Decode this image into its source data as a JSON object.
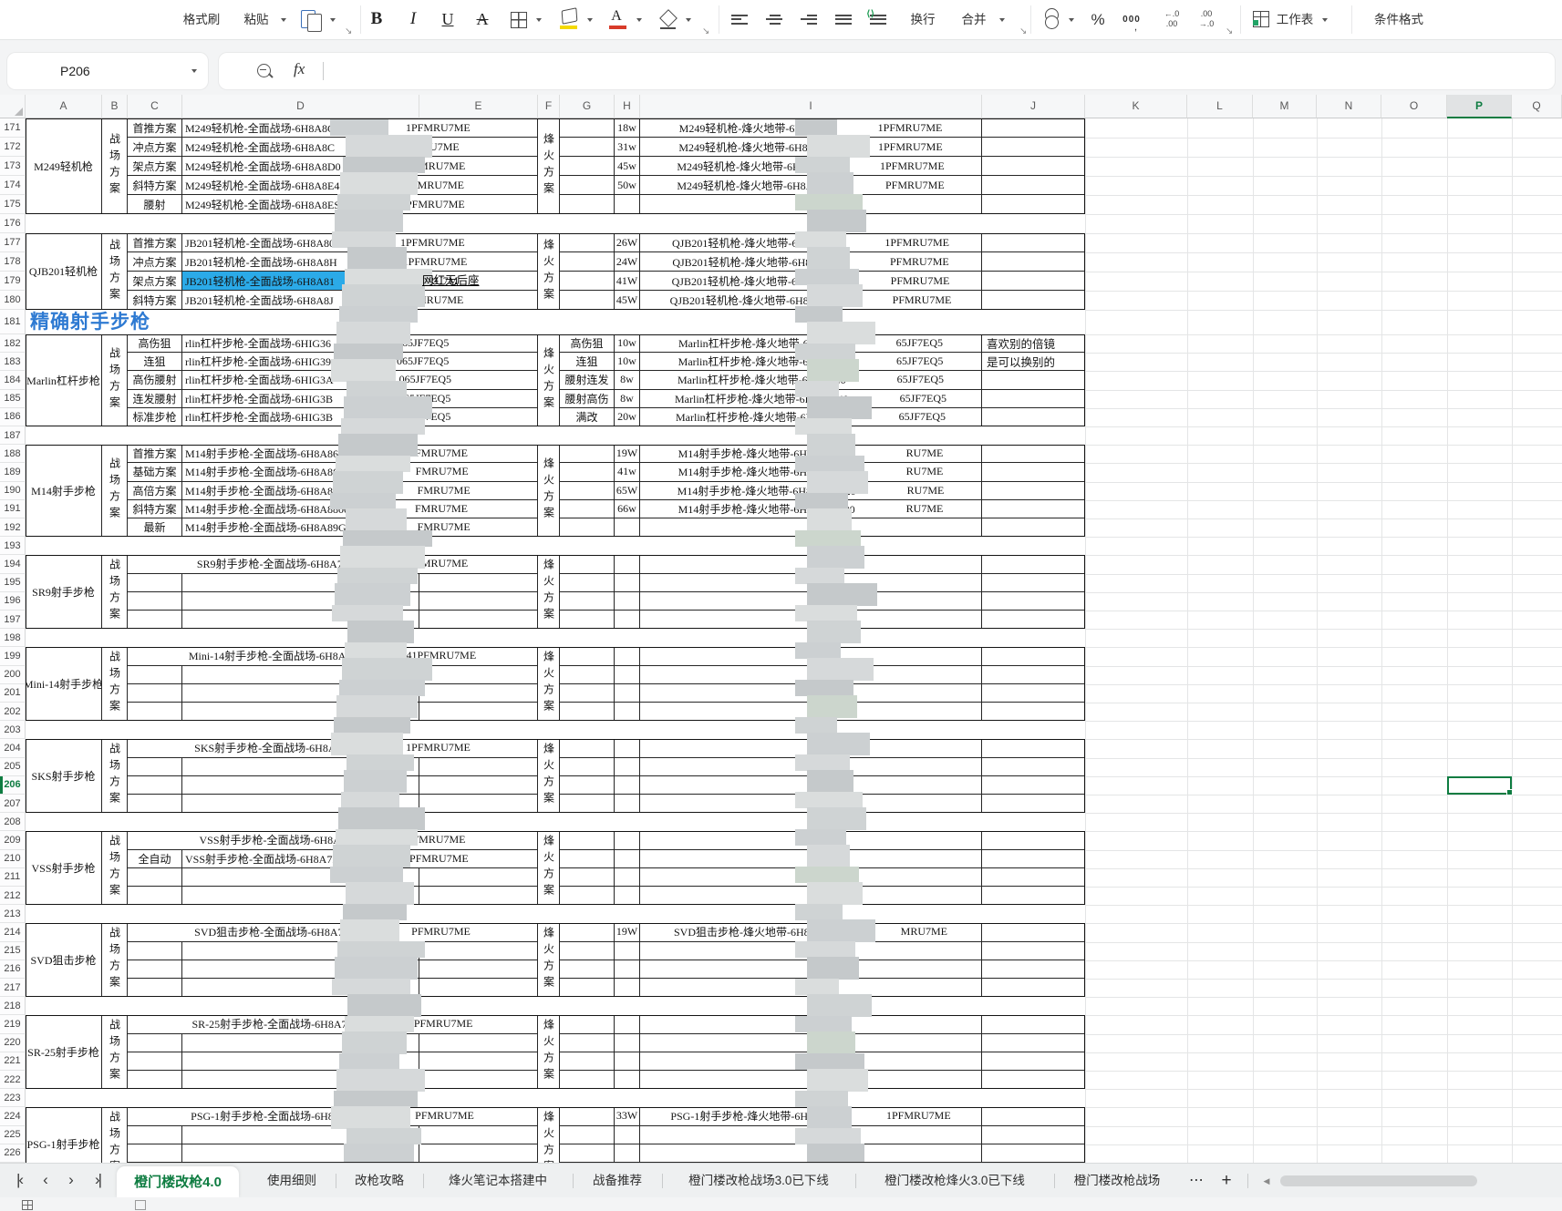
{
  "ribbon": {
    "format_painter": "格式刷",
    "paste": "粘贴",
    "bold": "B",
    "italic": "I",
    "underline": "U",
    "strike": "A",
    "wrap_text": "换行",
    "merge": "合并",
    "percent": "%",
    "thousands": "000",
    "dec_inc_top": "←.0",
    "dec_inc_bottom": ".00",
    "dec_dec_top": ".00",
    "dec_dec_bottom": "→.0",
    "worksheet": "工作表",
    "conditional_format": "条件格式"
  },
  "formula_bar": {
    "name_box": "P206",
    "fx": "fx"
  },
  "grid": {
    "col_headers": [
      "A",
      "B",
      "C",
      "D",
      "E",
      "F",
      "G",
      "H",
      "I",
      "J",
      "K",
      "L",
      "M",
      "N",
      "O",
      "P",
      "Q"
    ],
    "selected_col": "P",
    "selected_cell": "P206",
    "selected_row_num": "206",
    "first_row": 171,
    "last_row": 226,
    "section_title": "精确射手步枪",
    "annotation": "网红无后座",
    "highlight_color": "#2baae8",
    "accent_green": "#0e7c41",
    "title_blue": "#2e7ad2"
  },
  "sections": [
    {
      "start": 171,
      "type": "A",
      "name": "M249轻机枪",
      "plan": "战场方案",
      "fire": "烽火方案",
      "rows": [
        {
          "c": "首推方案",
          "d1": "M249轻机枪-全面战场-6H8A8C4",
          "d2": "1PFMRU7ME",
          "g": "",
          "h": "18w",
          "i1": "M249轻机枪-烽火地带-6H8ABI",
          "i2": "1PFMRU7ME",
          "j": ""
        },
        {
          "c": "冲点方案",
          "d1": "M249轻机枪-全面战场-6H8A8C",
          "d2": "PFMRU7ME",
          "g": "",
          "h": "31w",
          "i1": "M249轻机枪-烽火地带-6H8ABJ",
          "i2": "1PFMRU7ME",
          "j": ""
        },
        {
          "c": "架点方案",
          "d1": "M249轻机枪-全面战场-6H8A8D0",
          "d2": "PFMRU7ME",
          "g": "",
          "h": "45w",
          "i1": "M249轻机枪-烽火地带-6H8ABJI",
          "i2": "1PFMRU7ME",
          "j": ""
        },
        {
          "c": "斜特方案",
          "d1": "M249轻机枪-全面战场-6H8A8E4",
          "d2": "PFMRU7ME",
          "g": "",
          "h": "50w",
          "i1": "M249轻机枪-烽火地带-6H8ABK4",
          "i2": "PFMRU7ME",
          "j": ""
        },
        {
          "c": "腰射",
          "d1": "M249轻机枪-全面战场-6H8A8ES",
          "d2": "PFMRU7ME",
          "g": "",
          "h": "",
          "i1": "",
          "i2": "",
          "j": ""
        }
      ]
    },
    {
      "start": 177,
      "type": "A",
      "name": "QJB201轻机枪",
      "plan": "战场方案",
      "fire": "烽火方案",
      "highlight_row": 2,
      "rows": [
        {
          "c": "首推方案",
          "d1": "JB201轻机枪-全面战场-6H8A80",
          "d2": "1PFMRU7ME",
          "g": "",
          "h": "26W",
          "i1": "QJB201轻机枪-烽火地带-6H8ABQ",
          "i2": "1PFMRU7ME",
          "j": ""
        },
        {
          "c": "冲点方案",
          "d1": "JB201轻机枪-全面战场-6H8A8H",
          "d2": "1PFMRU7ME",
          "g": "",
          "h": "24W",
          "i1": "QJB201轻机枪-烽火地带-6H8ABR0",
          "i2": "PFMRU7ME",
          "j": ""
        },
        {
          "c": "架点方案",
          "d1": "JB201轻机枪-全面战场-6H8A81",
          "d2": "1PFMRU7M",
          "g": "",
          "h": "41W",
          "i1": "QJB201轻机枪-烽火地带-6H8ABSK",
          "i2": "PFMRU7ME",
          "j": ""
        },
        {
          "c": "斜特方案",
          "d1": "JB201轻机枪-全面战场-6H8A8J",
          "d2": "1PFMRU7ME",
          "g": "",
          "h": "45W",
          "i1": "QJB201轻机枪-烽火地带-6H8ABT40",
          "i2": "PFMRU7ME",
          "j": ""
        }
      ]
    },
    {
      "start": 182,
      "type": "A",
      "name": "Marlin杠杆步枪",
      "plan": "战场方案",
      "fire": "烽火方案",
      "rows": [
        {
          "c": "高伤狙",
          "d1": "rlin杠杆步枪-全面战场-6HIG36",
          "d2": "065JF7EQ5",
          "g": "高伤狙",
          "h": "10w",
          "i1": "Marlin杠杆步枪-烽火地带-6HIH1JC",
          "i2": "65JF7EQ5",
          "j": "喜欢别的倍镜"
        },
        {
          "c": "连狙",
          "d1": "rlin杠杆步枪-全面战场-6HIG39",
          "d2": "065JF7EQ5",
          "g": "连狙",
          "h": "10w",
          "i1": "Marlin杠杆步枪-烽火地带-6HIH1L0",
          "i2": "65JF7EQ5",
          "j": "是可以换别的"
        },
        {
          "c": "高伤腰射",
          "d1": "rlin杠杆步枪-全面战场-6HIG3A",
          "d2": "065JF7EQ5",
          "g": "腰射连发",
          "h": "8w",
          "i1": "Marlin杠杆步枪-烽火地带-6HIH1N0",
          "i2": "65JF7EQ5",
          "j": ""
        },
        {
          "c": "连发腰射",
          "d1": "rlin杠杆步枪-全面战场-6HIG3B",
          "d2": "065JF7EQ5",
          "g": "腰射高伤",
          "h": "8w",
          "i1": "Marlin杠杆步枪-烽火地带-6HIH1O40",
          "i2": "65JF7EQ5",
          "j": ""
        },
        {
          "c": "标准步枪",
          "d1": "rlin杠杆步枪-全面战场-6HIG3B",
          "d2": "065JF7EQ5",
          "g": "满改",
          "h": "20w",
          "i1": "Marlin杠杆步枪-烽火地带-6HIH1P80",
          "i2": "65JF7EQ5",
          "j": ""
        }
      ]
    },
    {
      "start": 188,
      "type": "A",
      "name": "M14射手步枪",
      "plan": "战场方案",
      "fire": "烽火方案",
      "rows": [
        {
          "c": "首推方案",
          "d1": "M14射手步枪-全面战场-6H8A8640",
          "d2": "FMRU7ME",
          "g": "",
          "h": "19W",
          "i1": "M14射手步枪-烽火地带-6H8AC24020",
          "i2": "RU7ME",
          "j": ""
        },
        {
          "c": "基础方案",
          "d1": "M14射手步枪-全面战场-6H8A86S0",
          "d2": "FMRU7ME",
          "g": "",
          "h": "41w",
          "i1": "M14射手步枪-烽火地带-6H8AC20020",
          "i2": "RU7ME",
          "j": ""
        },
        {
          "c": "高倍方案",
          "d1": "M14射手步枪-全面战场-6H8A87K0",
          "d2": "FMRU7ME",
          "g": "",
          "h": "65W",
          "i1": "M14射手步枪-烽火地带-6H8AC3C020",
          "i2": "RU7ME",
          "j": ""
        },
        {
          "c": "斜特方案",
          "d1": "M14射手步枪-全面战场-6H8A8800",
          "d2": "FMRU7ME",
          "g": "",
          "h": "66w",
          "i1": "M14射手步枪-烽火地带-6H8AC40020",
          "i2": "RU7ME",
          "j": ""
        },
        {
          "c": "最新",
          "d1": "M14射手步枪-全面战场-6H8A89G0",
          "d2": "FMRU7ME",
          "g": "",
          "h": "",
          "i1": "",
          "i2": "",
          "j": ""
        }
      ]
    },
    {
      "start": 194,
      "type": "B",
      "name": "SR9射手步枪",
      "plan": "战场方案",
      "fire": "烽火方案",
      "len": 4,
      "code1": "SR9射手步枪-全面战场-6H8A7JC",
      "code2": "PFMRU7ME",
      "h": "",
      "i1": "",
      "i2": ""
    },
    {
      "start": 199,
      "type": "B",
      "name": "Mini-14射手步枪",
      "plan": "战场方案",
      "fire": "烽火方案",
      "len": 4,
      "code1": "Mini-14射手步枪-全面战场-6H8A7",
      "code2": "41PFMRU7ME",
      "h": "",
      "i1": "",
      "i2": ""
    },
    {
      "start": 204,
      "type": "B",
      "name": "SKS射手步枪",
      "plan": "战场方案",
      "fire": "烽火方案",
      "len": 4,
      "code1": "SKS射手步枪-全面战场-6H8A7M",
      "code2": "1PFMRU7ME",
      "h": "",
      "i1": "",
      "i2": ""
    },
    {
      "start": 209,
      "type": "B",
      "name": "VSS射手步枪",
      "plan": "战场方案",
      "fire": "烽火方案",
      "len": 4,
      "code1": "VSS射手步枪-全面战场-6H8A70",
      "code2": "PFMRU7ME",
      "h": "",
      "i1": "",
      "i2": "",
      "sub_c": "全自动",
      "sub_d1": "VSS射手步枪-全面战场-6H8A7P4",
      "sub_d2": "PFMRU7ME"
    },
    {
      "start": 214,
      "type": "B",
      "name": "SVD狙击步枪",
      "plan": "战场方案",
      "fire": "烽火方案",
      "len": 4,
      "code1": "SVD狙击步枪-全面战场-6H8A7N0",
      "code2": "PFMRU7ME",
      "h": "19W",
      "i1": "SVD狙击步枪-烽火地带-6H8ACDS02",
      "i2": "MRU7ME"
    },
    {
      "start": 219,
      "type": "B",
      "name": "SR-25射手步枪",
      "plan": "战场方案",
      "fire": "烽火方案",
      "len": 4,
      "code1": "SR-25射手步枪-全面战场-6H8A7L",
      "code2": "1PFMRU7ME",
      "h": "",
      "i1": "",
      "i2": ""
    },
    {
      "start": 224,
      "type": "B",
      "name": "PSG-1射手步枪",
      "plan": "战场方案",
      "fire": "烽火方案",
      "len": 4,
      "code1": "PSG-1射手步枪-全面战场-6H8A7H8",
      "code2": "PFMRU7ME",
      "h": "33W",
      "i1": "PSG-1射手步枪-烽火地带-6H8ACL",
      "i2": "1PFMRU7ME"
    }
  ],
  "tabs": {
    "nav_first": "|‹",
    "nav_prev": "‹",
    "nav_next": "›",
    "nav_last": "›|",
    "active": "橙门楼改枪4.0",
    "items": [
      "使用细则",
      "改枪攻略",
      "烽火笔记本搭建中",
      "战备推荐",
      "橙门楼改枪战场3.0已下线",
      "橙门楼改枪烽火3.0已下线",
      "橙门楼改枪战场"
    ],
    "more": "⋯",
    "add": "+",
    "scroll_left": "◀"
  }
}
